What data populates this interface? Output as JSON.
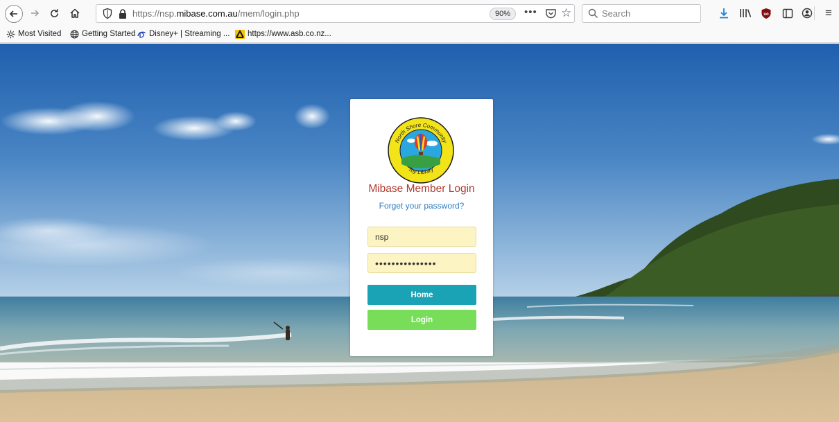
{
  "browser": {
    "url_prefix": "https://nsp.",
    "url_domain": "mibase.com.au",
    "url_path": "/mem/login.php",
    "zoom": "90%",
    "more_label": "•••",
    "search_placeholder": "Search",
    "menu_glyph": "≡"
  },
  "bookmarks": [
    {
      "label": "Most Visited",
      "icon": "gear-icon"
    },
    {
      "label": "Getting Started",
      "icon": "globe-icon"
    },
    {
      "label": "Disney+ | Streaming ...",
      "icon": "disney-icon"
    },
    {
      "label": "https://www.asb.co.nz...",
      "icon": "asb-icon"
    }
  ],
  "logo": {
    "text_top": "North Shore Community",
    "text_bottom": "Toy Library"
  },
  "login": {
    "title": "Mibase Member Login",
    "forgot_label": "Forget your password?",
    "username_value": "nsp",
    "password_value": "•••••••••••••••",
    "home_label": "Home",
    "login_label": "Login"
  },
  "colors": {
    "title": "#b13a2e",
    "link": "#2f7cc1",
    "home_button": "#1aa3b5",
    "login_button": "#78de5a",
    "field_bg": "#fcf4c2"
  }
}
